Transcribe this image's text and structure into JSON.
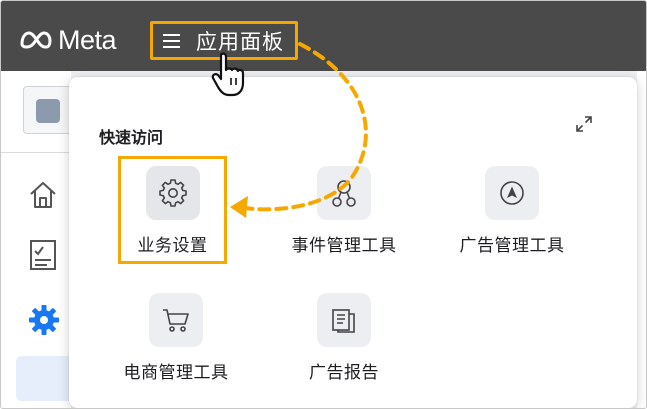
{
  "topbar": {
    "brand": "Meta",
    "menu_label": "应用面板"
  },
  "panel": {
    "section_title": "快速访问",
    "tiles": [
      {
        "label": "业务设置",
        "icon": "gear-icon",
        "selected": true
      },
      {
        "label": "事件管理工具",
        "icon": "events-network-icon"
      },
      {
        "label": "广告管理工具",
        "icon": "ads-manager-icon"
      },
      {
        "label": "电商管理工具",
        "icon": "shopping-cart-icon"
      },
      {
        "label": "广告报告",
        "icon": "reports-icon"
      }
    ]
  },
  "colors": {
    "highlight": "#f5a800",
    "topbar": "#4a4a4a",
    "tile_bg": "#eceef1"
  }
}
